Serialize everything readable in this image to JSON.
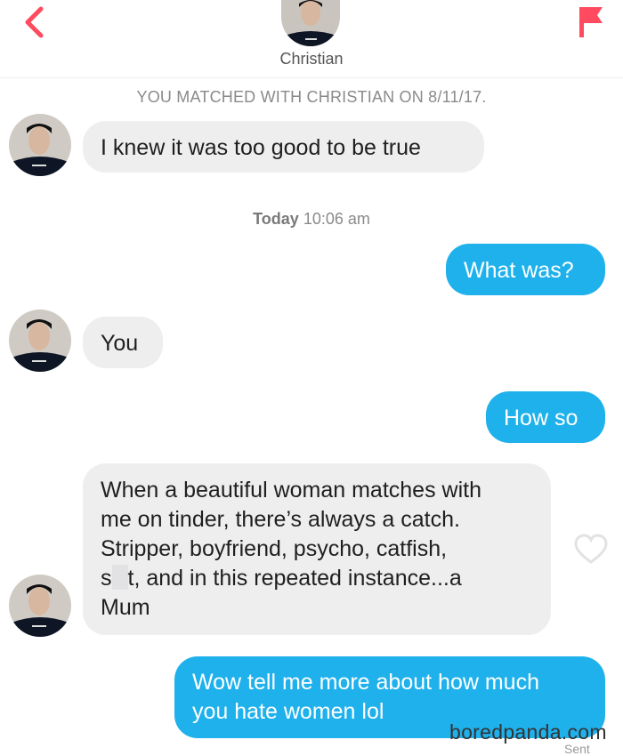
{
  "header": {
    "match_name": "Christian",
    "icons": {
      "back": "back-chevron-icon",
      "report": "report-flag-icon"
    },
    "colors": {
      "accent": "#ff4a60"
    }
  },
  "banner": {
    "text": "YOU MATCHED WITH CHRISTIAN ON 8/11/17."
  },
  "timestamp": {
    "day": "Today",
    "time": "10:06 am"
  },
  "messages": [
    {
      "from": "match",
      "text": "I knew it was too good to be true"
    },
    {
      "from": "me",
      "text": "What was?"
    },
    {
      "from": "match",
      "text": "You"
    },
    {
      "from": "me",
      "text": "How so"
    },
    {
      "from": "match",
      "lines": [
        "When a beautiful woman matches with",
        "me on tinder, there’s always a catch.",
        "Stripper, boyfriend, psycho, catfish,",
        "t, and in this repeated instance...a",
        "Mum"
      ],
      "line4_prefix": "s"
    },
    {
      "from": "me",
      "lines": [
        "Wow tell me more about how much",
        "you hate women lol"
      ]
    }
  ],
  "colors": {
    "outgoing_bubble": "#1fb1ec",
    "incoming_bubble": "#eeeeef"
  },
  "status": {
    "sent": "Sent"
  },
  "watermark": "boredpanda.com"
}
